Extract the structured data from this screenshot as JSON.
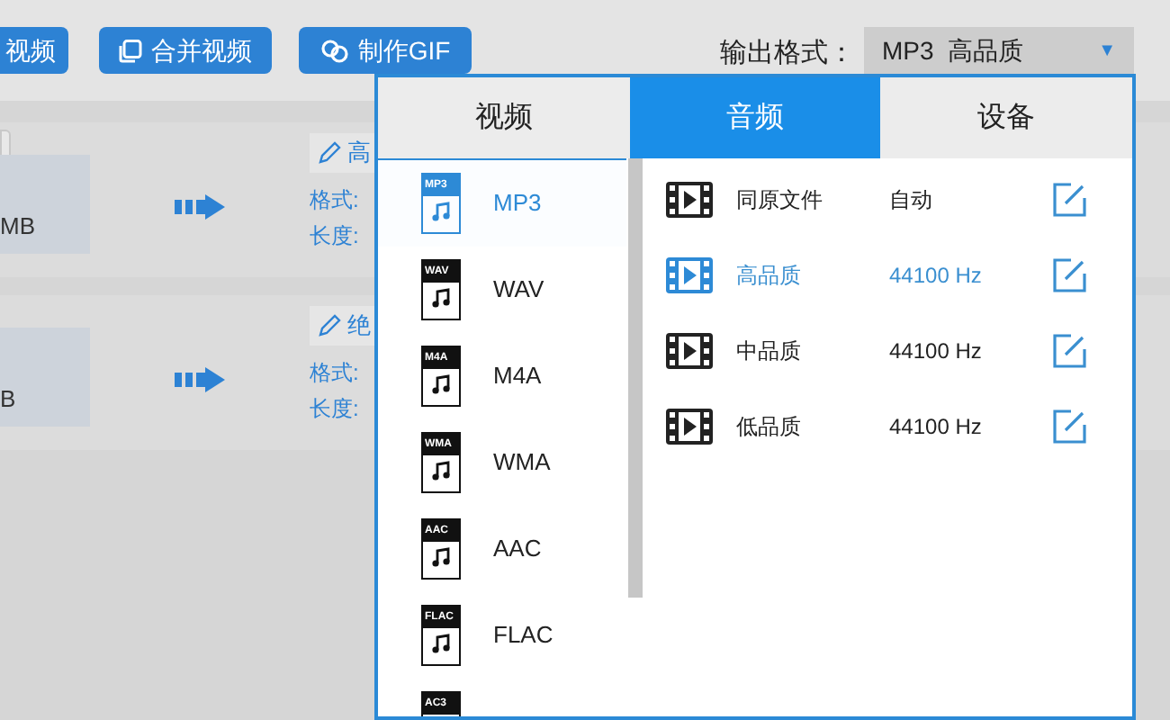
{
  "toolbar": {
    "buttons": [
      {
        "label": "视频"
      },
      {
        "label": "合并视频"
      },
      {
        "label": "制作GIF"
      }
    ],
    "output_format_label": "输出格式：",
    "output_format_value": "MP3  高品质",
    "dropdown_arrow": "▼"
  },
  "tasks": [
    {
      "size": "MB",
      "name": "高",
      "format_label": "格式:",
      "length_label": "长度:"
    },
    {
      "size": "B",
      "name": "绝",
      "format_label": "格式:",
      "length_label": "长度:"
    }
  ],
  "format_popup": {
    "tabs": [
      {
        "label": "视频",
        "selected": false
      },
      {
        "label": "音频",
        "selected": true
      },
      {
        "label": "设备",
        "selected": false
      }
    ],
    "formats": [
      {
        "icon_label": "MP3",
        "name": "MP3",
        "selected": true
      },
      {
        "icon_label": "WAV",
        "name": "WAV",
        "selected": false
      },
      {
        "icon_label": "M4A",
        "name": "M4A",
        "selected": false
      },
      {
        "icon_label": "WMA",
        "name": "WMA",
        "selected": false
      },
      {
        "icon_label": "AAC",
        "name": "AAC",
        "selected": false
      },
      {
        "icon_label": "FLAC",
        "name": "FLAC",
        "selected": false
      },
      {
        "icon_label": "AC3",
        "selected": false
      }
    ],
    "presets": [
      {
        "name": "同原文件",
        "rate": "自动",
        "selected": false
      },
      {
        "name": "高品质",
        "rate": "44100 Hz",
        "selected": true
      },
      {
        "name": "中品质",
        "rate": "44100 Hz",
        "selected": false
      },
      {
        "name": "低品质",
        "rate": "44100 Hz",
        "selected": false
      }
    ]
  }
}
